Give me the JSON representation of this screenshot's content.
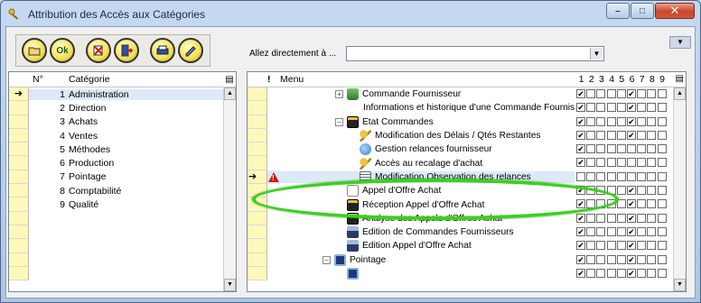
{
  "window": {
    "title": "Attribution des Accès aux Catégories",
    "controls": {
      "minimize": "–",
      "maximize": "□",
      "close": "✕"
    }
  },
  "toolbar": {
    "buttons": [
      {
        "name": "open-folder-button",
        "icon": "folder-icon",
        "label": ""
      },
      {
        "name": "ok-button",
        "icon": "ok-icon",
        "label": "Ok"
      },
      {
        "name": "delete-button",
        "icon": "delete-icon",
        "label": ""
      },
      {
        "name": "exit-button",
        "icon": "exit-icon",
        "label": ""
      },
      {
        "name": "print-button",
        "icon": "printer-icon",
        "label": ""
      },
      {
        "name": "edit-button",
        "icon": "edit-icon",
        "label": ""
      }
    ],
    "corner_arrow": "▼"
  },
  "goto": {
    "label": "Allez directement à ...",
    "value": "",
    "arrow": "▼"
  },
  "categories": {
    "headers": {
      "num": "N°",
      "category": "Catégorie"
    },
    "selected_marker": "➔",
    "rows": [
      {
        "num": "1",
        "name": "Administration",
        "selected": true
      },
      {
        "num": "2",
        "name": "Direction"
      },
      {
        "num": "3",
        "name": "Achats"
      },
      {
        "num": "4",
        "name": "Ventes"
      },
      {
        "num": "5",
        "name": "Méthodes"
      },
      {
        "num": "6",
        "name": "Production"
      },
      {
        "num": "7",
        "name": "Pointage"
      },
      {
        "num": "8",
        "name": "Comptabilité"
      },
      {
        "num": "9",
        "name": "Qualité"
      },
      {
        "num": "",
        "name": ""
      },
      {
        "num": "",
        "name": ""
      },
      {
        "num": "",
        "name": ""
      },
      {
        "num": "",
        "name": ""
      },
      {
        "num": "",
        "name": ""
      }
    ]
  },
  "menus": {
    "headers": {
      "bang": "!",
      "menu": "Menu",
      "columns": [
        "1",
        "2",
        "3",
        "4",
        "5",
        "6",
        "7",
        "8",
        "9"
      ]
    },
    "check_mark": "✔",
    "rows": [
      {
        "indent": 1,
        "expander": "+",
        "icon": "folder",
        "label": "Commande Fournisseur",
        "checks": [
          1,
          0,
          0,
          0,
          0,
          1,
          0,
          0,
          0
        ]
      },
      {
        "indent": 2,
        "expander": "",
        "icon": "person",
        "label": "Informations et historique d'une Commande Fournisseur",
        "checks": [
          1,
          0,
          0,
          0,
          0,
          1,
          0,
          0,
          0
        ]
      },
      {
        "indent": 1,
        "expander": "–",
        "icon": "doc",
        "label": "Etat Commandes",
        "checks": [
          1,
          0,
          0,
          0,
          0,
          1,
          0,
          0,
          0
        ]
      },
      {
        "indent": 2,
        "expander": "",
        "icon": "key",
        "label": "Modification des Délais / Qtés Restantes",
        "checks": [
          1,
          0,
          0,
          0,
          0,
          1,
          0,
          0,
          0
        ]
      },
      {
        "indent": 2,
        "expander": "",
        "icon": "world",
        "label": "Gestion relances fournisseur",
        "checks": [
          1,
          0,
          0,
          0,
          0,
          0,
          0,
          0,
          0
        ]
      },
      {
        "indent": 2,
        "expander": "",
        "icon": "key",
        "label": "Accès au recalage d'achat",
        "checks": [
          1,
          0,
          0,
          0,
          0,
          0,
          0,
          0,
          0
        ]
      },
      {
        "indent": 2,
        "expander": "",
        "icon": "note",
        "label": "Modification Observation des relances",
        "checks": [
          0,
          0,
          0,
          0,
          0,
          0,
          0,
          0,
          0
        ],
        "selected": true,
        "warning": true
      },
      {
        "indent": 1,
        "expander": "",
        "icon": "page",
        "label": "Appel d'Offre Achat",
        "checks": [
          1,
          0,
          0,
          0,
          0,
          1,
          0,
          0,
          0
        ]
      },
      {
        "indent": 1,
        "expander": "",
        "icon": "doc",
        "label": "Réception Appel d'Offre Achat",
        "checks": [
          1,
          0,
          0,
          0,
          0,
          1,
          0,
          0,
          0
        ]
      },
      {
        "indent": 1,
        "expander": "",
        "icon": "doc",
        "label": "Analyse des Appels d'Offres Achat",
        "checks": [
          1,
          0,
          0,
          0,
          0,
          1,
          0,
          0,
          0
        ]
      },
      {
        "indent": 1,
        "expander": "",
        "icon": "printer",
        "label": "Edition de Commandes Fournisseurs",
        "checks": [
          1,
          0,
          0,
          0,
          0,
          1,
          0,
          0,
          0
        ]
      },
      {
        "indent": 1,
        "expander": "",
        "icon": "printer",
        "label": "Edition Appel d'Offre Achat",
        "checks": [
          1,
          0,
          0,
          0,
          0,
          1,
          0,
          0,
          0
        ]
      },
      {
        "indent": 0,
        "expander": "–",
        "icon": "screen",
        "label": "Pointage",
        "checks": [
          1,
          0,
          0,
          0,
          0,
          1,
          0,
          0,
          0
        ]
      },
      {
        "indent": 1,
        "expander": "",
        "icon": "screen",
        "label": "",
        "checks": [
          1,
          0,
          0,
          0,
          0,
          1,
          0,
          0,
          0
        ]
      }
    ]
  },
  "colors": {
    "highlight_ellipse": "#3ccf1e",
    "marker_column": "#fff8b8",
    "selection": "#dce9f7"
  }
}
